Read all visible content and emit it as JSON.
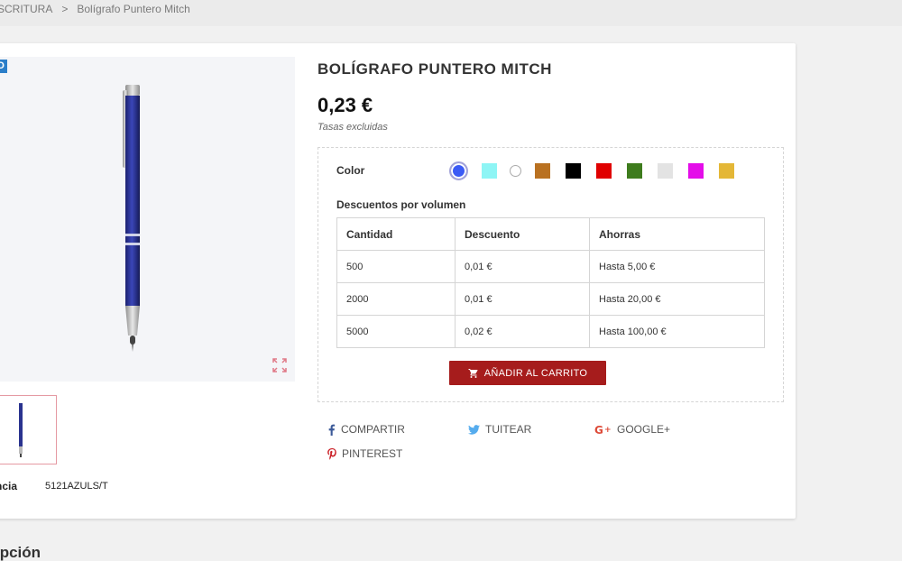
{
  "breadcrumb": {
    "items": [
      "SCRITURA",
      "Bolígrafo Puntero Mitch"
    ],
    "separator": ">"
  },
  "product": {
    "badge": "VO",
    "title": "BOLÍGRAFO PUNTERO MITCH",
    "price": "0,23 €",
    "tax_note": "Tasas excluidas",
    "reference_label": "ncia",
    "reference_value": "5121AZULS/T"
  },
  "options": {
    "color_label": "Color",
    "swatches": [
      {
        "name": "blue",
        "color": "#3b5bf5",
        "shape": "circle",
        "selected": true
      },
      {
        "name": "cyan",
        "color": "#8ef5f5",
        "shape": "square"
      },
      {
        "name": "white",
        "color": "#ffffff",
        "shape": "circle"
      },
      {
        "name": "brown",
        "color": "#b97121",
        "shape": "square"
      },
      {
        "name": "black",
        "color": "#000000",
        "shape": "square"
      },
      {
        "name": "red",
        "color": "#e00000",
        "shape": "square"
      },
      {
        "name": "green",
        "color": "#3e7c1d",
        "shape": "square"
      },
      {
        "name": "light-grey",
        "color": "#e3e3e3",
        "shape": "square"
      },
      {
        "name": "magenta",
        "color": "#e40de9",
        "shape": "square"
      },
      {
        "name": "gold",
        "color": "#e4b737",
        "shape": "square"
      }
    ]
  },
  "volume_discounts": {
    "label": "Descuentos por volumen",
    "headers": [
      "Cantidad",
      "Descuento",
      "Ahorras"
    ],
    "rows": [
      [
        "500",
        "0,01 €",
        "Hasta 5,00 €"
      ],
      [
        "2000",
        "0,01 €",
        "Hasta 20,00 €"
      ],
      [
        "5000",
        "0,02 €",
        "Hasta 100,00 €"
      ]
    ]
  },
  "cart": {
    "label": "AÑADIR AL CARRITO",
    "icon": "cart-icon"
  },
  "share": {
    "facebook": "COMPARTIR",
    "twitter": "TUITEAR",
    "google": "GOOGLE+",
    "pinterest": "PINTEREST"
  },
  "description_heading": "ipción",
  "colors": {
    "accent_red": "#a61c1c",
    "badge_blue": "#2b7ec9",
    "facebook": "#3b5998",
    "twitter": "#55acee",
    "google": "#dd4b39",
    "pinterest": "#cb2027"
  }
}
